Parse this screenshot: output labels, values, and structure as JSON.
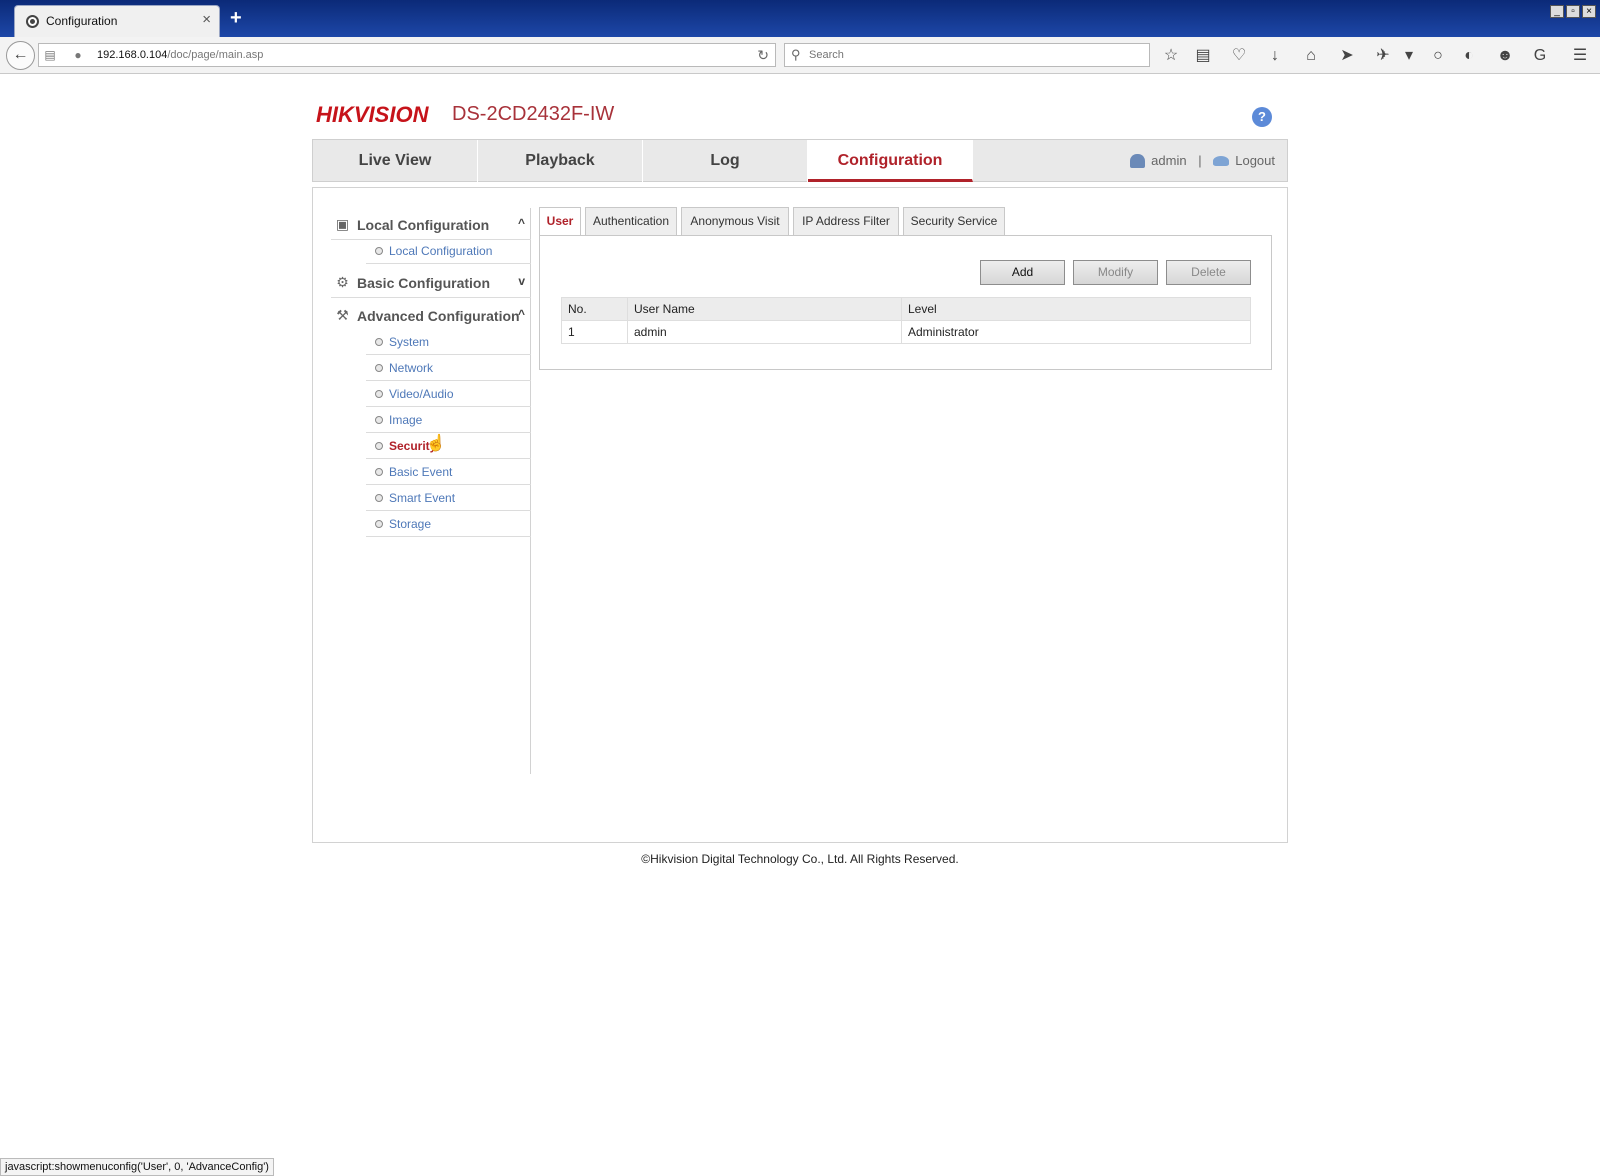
{
  "browser": {
    "tab_title": "Configuration",
    "tab_close": "×",
    "new_tab": "+",
    "url_host": "192.168.0.104",
    "url_path": "/doc/page/main.asp",
    "search_placeholder": "Search",
    "status_text": "javascript:showmenuconfig('User', 0, 'AdvanceConfig')",
    "window_controls": [
      "_",
      "▫",
      "×"
    ]
  },
  "header": {
    "logo": "HIKVISION",
    "model": "DS-2CD2432F-IW",
    "help": "?"
  },
  "topnav": {
    "items": [
      {
        "label": "Live View",
        "active": false
      },
      {
        "label": "Playback",
        "active": false
      },
      {
        "label": "Log",
        "active": false
      },
      {
        "label": "Configuration",
        "active": true
      }
    ],
    "user": "admin",
    "separator": "|",
    "logout": "Logout"
  },
  "sidebar": {
    "local": {
      "label": "Local Configuration",
      "chevron": "^",
      "items": [
        {
          "label": "Local Configuration"
        }
      ]
    },
    "basic": {
      "label": "Basic Configuration",
      "chevron": "v"
    },
    "advanced": {
      "label": "Advanced Configuration",
      "chevron": "^",
      "items": [
        {
          "label": "System"
        },
        {
          "label": "Network"
        },
        {
          "label": "Video/Audio"
        },
        {
          "label": "Image"
        },
        {
          "label": "Security",
          "active": true
        },
        {
          "label": "Basic Event"
        },
        {
          "label": "Smart Event"
        },
        {
          "label": "Storage"
        }
      ]
    }
  },
  "main": {
    "tabs": [
      {
        "label": "User",
        "active": true
      },
      {
        "label": "Authentication"
      },
      {
        "label": "Anonymous Visit"
      },
      {
        "label": "IP Address Filter"
      },
      {
        "label": "Security Service"
      }
    ],
    "buttons": {
      "add": "Add",
      "modify": "Modify",
      "delete": "Delete"
    },
    "table": {
      "headers": [
        "No.",
        "User Name",
        "Level"
      ],
      "rows": [
        [
          "1",
          "admin",
          "Administrator"
        ]
      ]
    }
  },
  "footer": {
    "copyright": "©Hikvision Digital Technology Co., Ltd. All Rights Reserved."
  }
}
